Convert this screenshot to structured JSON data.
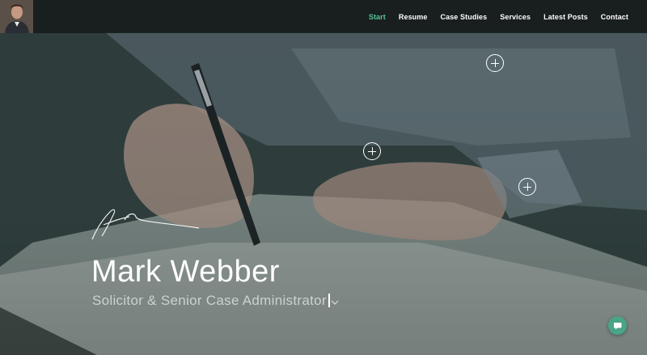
{
  "nav": {
    "items": [
      {
        "label": "Start",
        "active": true
      },
      {
        "label": "Resume"
      },
      {
        "label": "Case Studies"
      },
      {
        "label": "Services"
      },
      {
        "label": "Latest Posts"
      },
      {
        "label": "Contact"
      }
    ]
  },
  "hero": {
    "name": "Mark Webber",
    "subtitle": "Solicitor & Senior Case Administrator"
  },
  "colors": {
    "accent": "#58c29a",
    "chat_button": "#4aa487",
    "nav_bg": "#141818"
  },
  "icons": {
    "hotspot": "plus-circle-icon",
    "scroll": "chevron-down-icon",
    "chat": "chat-bubble-icon"
  }
}
